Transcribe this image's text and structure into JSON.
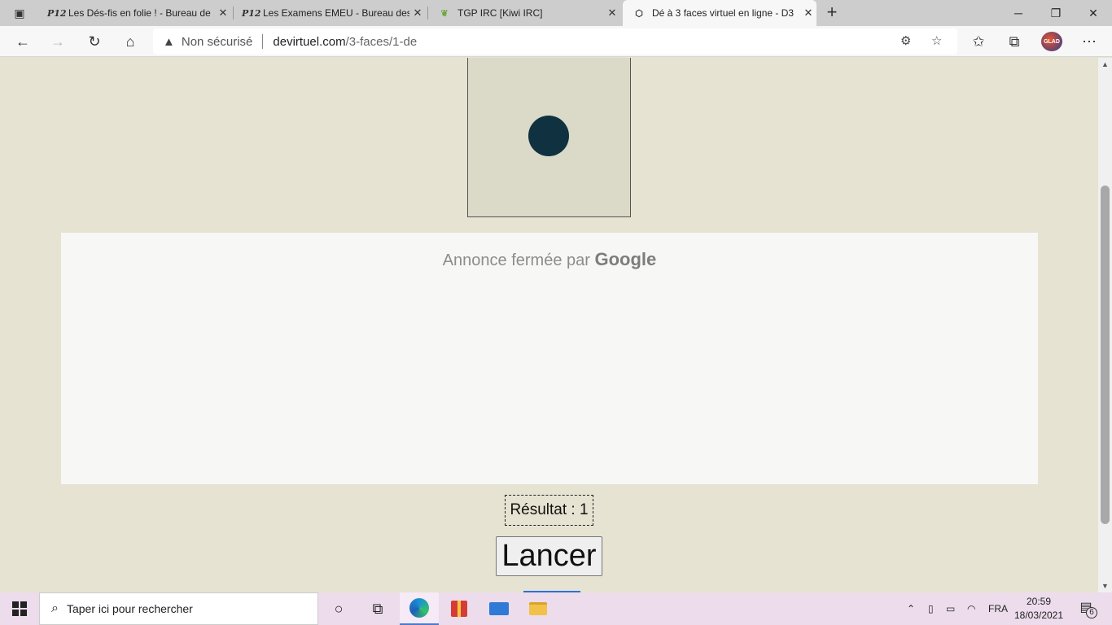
{
  "browser": {
    "tabs": [
      {
        "favicon": "P12",
        "title": "Les Dés-fis en folie ! - Bureau de",
        "active": false
      },
      {
        "favicon": "P12",
        "title": "Les Examens EMEU - Bureau des",
        "active": false
      },
      {
        "favicon": "leaf-icon",
        "title": "TGP IRC [Kiwi IRC]",
        "active": false
      },
      {
        "favicon": "die-icon",
        "title": "Dé à 3 faces virtuel en ligne - D3",
        "active": true
      }
    ],
    "address": {
      "security_label": "Non sécurisé",
      "host": "devirtuel.com",
      "path": "/3-faces/1-de"
    },
    "profile_label": "GLAD"
  },
  "page": {
    "die": {
      "face_value": 1,
      "pip_color": "#0f3140"
    },
    "ad": {
      "closed_text": "Annonce fermée par",
      "brand": "Google"
    },
    "result_text": "Résultat : 1",
    "roll_button_label": "Lancer"
  },
  "taskbar": {
    "search_placeholder": "Taper ici pour rechercher",
    "language": "FRA",
    "time": "20:59",
    "date": "18/03/2021",
    "notification_count": "6"
  },
  "colors": {
    "page_background": "#e7e3d2",
    "die_face": "#dbd9c7",
    "ad_background": "#f7f8f6"
  }
}
